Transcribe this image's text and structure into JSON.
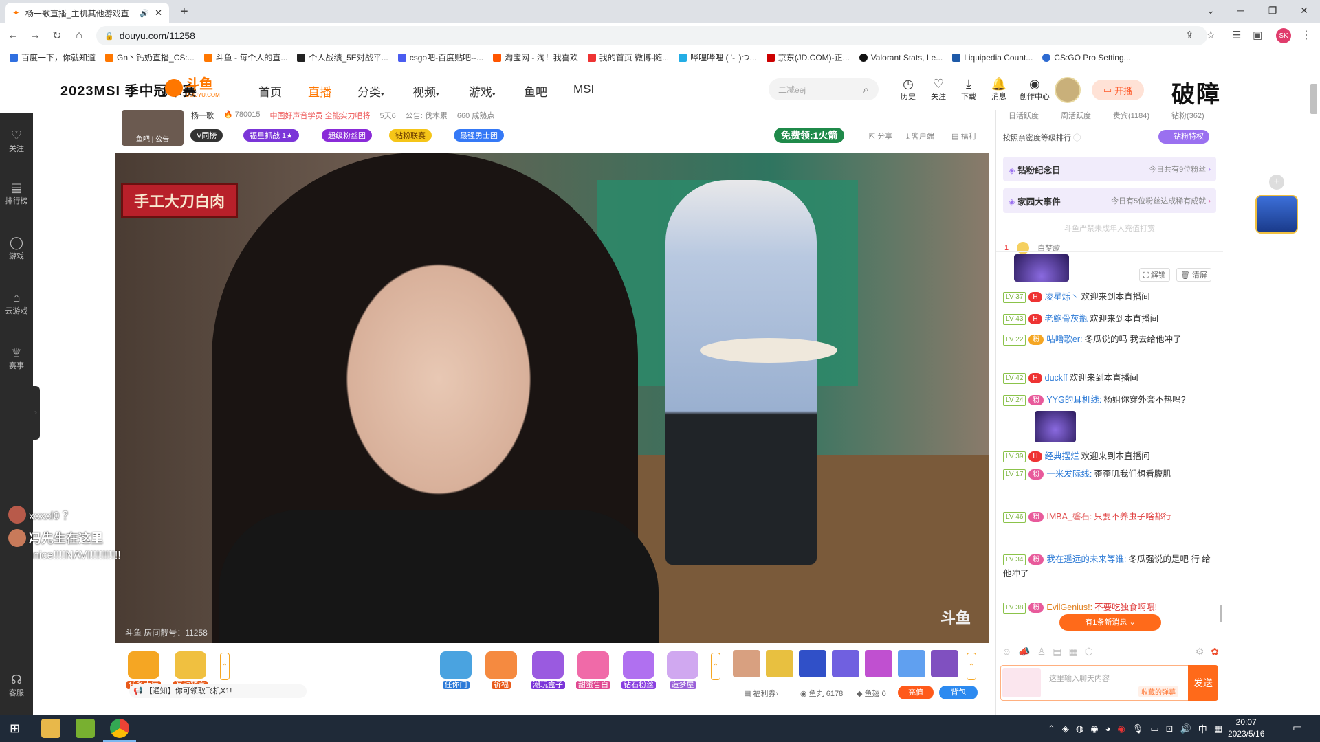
{
  "browser": {
    "tab_title": "杨一歌直播_主机其他游戏直",
    "url": "douyu.com/11258",
    "bookmarks": [
      "百度一下，你就知道",
      "Gn丶钙奶直播_CS:...",
      "斗鱼 - 每个人的直...",
      "个人战绩_5E对战平...",
      "csgo吧-百度贴吧--...",
      "淘宝网 - 淘！我喜欢",
      "我的首页 微博-随...",
      "哔哩哔哩 ( '- ')つ...",
      "京东(JD.COM)-正...",
      "Valorant Stats, Le...",
      "Liquipedia Count...",
      "CS:GO Pro Setting..."
    ],
    "profile_initials": "SK"
  },
  "site": {
    "logo_left": "2023MSI 季中冠军赛",
    "logo_brand": "斗鱼",
    "logo_brand_sub": "DOUYU.COM",
    "nav": [
      "首页",
      "直播",
      "分类",
      "视频",
      "游戏",
      "鱼吧",
      "MSI"
    ],
    "search_placeholder": "二减eej",
    "header_icons": [
      "历史",
      "关注",
      "下载",
      "消息",
      "创作中心"
    ],
    "live_button": "开播",
    "right_banner": "破障"
  },
  "rail": [
    "关注",
    "排行榜",
    "游戏",
    "云游戏",
    "赛事",
    "客服"
  ],
  "room": {
    "streamer": "杨一歌",
    "hot": "780015",
    "tag": "中国好声音学员 全能实力唱将",
    "followers": "5天6",
    "notice": "公告: 伐木累",
    "fans": "660 成熟点",
    "avatar_label": "鱼吧 | 公告",
    "pills": [
      "V同榜",
      "福星抓战 1★",
      "超级粉丝团",
      "钻粉联赛",
      "最强勇士团"
    ],
    "free_rocket": "免费领:1火箭",
    "actions": [
      "分享",
      "客户端",
      "福利"
    ],
    "watermark_room": "斗鱼 房间靓号：11258",
    "video_sign": "手工大刀白肉"
  },
  "danmaku": [
    "xxxxl0 ？",
    "冯先生在这里",
    "nice!!!!NAVI!!!!!!!!!!"
  ],
  "gifts": {
    "left": [
      "任务大厅",
      "互动预言"
    ],
    "right": [
      "任你门",
      "祈福",
      "潮玩盒子",
      "甜蜜告白",
      "钻石粉丝",
      "造梦屋"
    ],
    "notice": "【通知】你可领取飞机X1!",
    "welfare": "福利券",
    "fish_balls": "鱼丸 6178",
    "fish_fin": "鱼翅 0",
    "recharge": "充值",
    "backpack": "背包"
  },
  "chat": {
    "tabs": [
      "日活跃度",
      "周活跃度",
      "贵宾(1184)",
      "钻粉(362)"
    ],
    "rank_note": "按照亲密度等级排行",
    "diamond_button": "钻粉特权",
    "event1_title": "钻粉纪念日",
    "event1_desc": "今日共有9位粉丝",
    "event2_title": "家园大事件",
    "event2_desc": "今日有5位粉丝达成稀有成就",
    "minor_note": "斗鱼严禁未成年人充值打赏",
    "rank1_name": "白梦歌",
    "unlock": "解锁",
    "clear": "清屏",
    "messages": [
      {
        "lv": "LV 37",
        "user": "凌星烁丶",
        "text": "欢迎来到本直播间"
      },
      {
        "lv": "LV 43",
        "user": "老鲍骨灰瓶",
        "text": "欢迎来到本直播间"
      },
      {
        "lv": "LV 22",
        "user": "咕噜歌er:",
        "text": "冬瓜说的吗 我去给他冲了"
      },
      {
        "lv": "LV 42",
        "user": "duckff",
        "text": "欢迎来到本直播间"
      },
      {
        "lv": "LV 24",
        "user": "YYG的耳机线:",
        "text": "杨姐你穿外套不热吗?"
      },
      {
        "lv": "LV 39",
        "user": "经典摆烂",
        "text": "欢迎来到本直播间"
      },
      {
        "lv": "LV 17",
        "user": "一米发际线:",
        "text": "歪歪叽我们想看腹肌"
      },
      {
        "lv": "LV 46",
        "user": "IMBA_磐石:",
        "text": "只要不养虫子啥都行"
      },
      {
        "lv": "LV 34",
        "user": "我在遥远的未来等谁:",
        "text": "冬瓜强说的是吧 行 给他冲了"
      },
      {
        "lv": "LV 38",
        "user": "EvilGenius!:",
        "text": "不要吃独食啊喂!"
      }
    ],
    "new_msgs": "有1条新消息",
    "input_placeholder": "这里输入聊天内容",
    "barrage_label": "收藏的弹幕",
    "send": "发送"
  },
  "taskbar": {
    "time": "20:07",
    "date": "2023/5/16",
    "ime": "中"
  },
  "colors": {
    "brand": "#ff7700",
    "pink": "#e85a9b",
    "green": "#7cb342"
  }
}
